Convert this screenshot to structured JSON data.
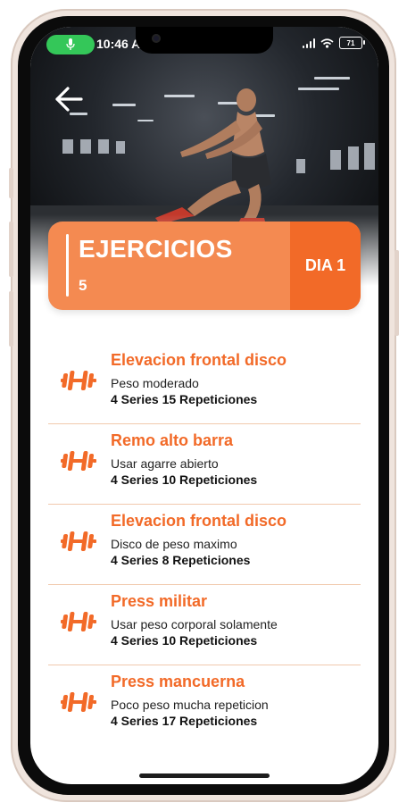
{
  "status_bar": {
    "time": "10:46 A",
    "battery": "71"
  },
  "header": {
    "title": "EJERCICIOS",
    "count": "5",
    "day": "DIA 1"
  },
  "exercises": [
    {
      "name": "Elevacion frontal disco",
      "description": "Peso moderado",
      "reps": "4 Series 15 Repeticiones"
    },
    {
      "name": "Remo alto barra",
      "description": "Usar agarre abierto",
      "reps": "4 Series 10 Repeticiones"
    },
    {
      "name": "Elevacion frontal disco",
      "description": "Disco de peso maximo",
      "reps": "4 Series 8 Repeticiones"
    },
    {
      "name": "Press militar",
      "description": "Usar peso corporal solamente",
      "reps": "4 Series 10 Repeticiones"
    },
    {
      "name": "Press mancuerna",
      "description": "Poco peso mucha repeticion",
      "reps": "4 Series 17 Repeticiones"
    }
  ],
  "icons": {
    "back": "arrow-left-icon",
    "exercise": "dumbbell-icon",
    "mic": "microphone-icon",
    "wifi": "wifi-icon",
    "signal": "cellular-signal-icon",
    "battery": "battery-icon"
  },
  "colors": {
    "accent": "#f26a28",
    "accent_light": "#f48a51",
    "divider": "#f1c9ad",
    "status_green": "#34c759"
  }
}
